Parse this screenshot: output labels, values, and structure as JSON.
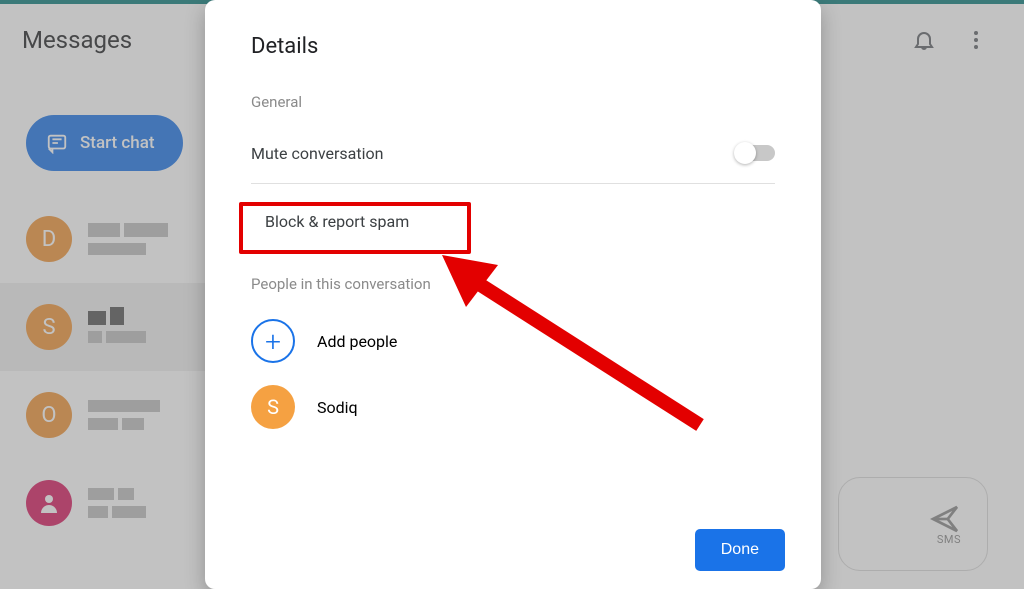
{
  "app": {
    "title": "Messages"
  },
  "header": {
    "bell_icon": "notifications",
    "more_icon": "more"
  },
  "start_chat": {
    "label": "Start chat"
  },
  "conversations": [
    {
      "initial": "D",
      "color": "#f09436"
    },
    {
      "initial": "S",
      "color": "#f09436"
    },
    {
      "initial": "O",
      "color": "#f09436"
    },
    {
      "initial": "",
      "color": "#d81b60",
      "person_icon": true
    }
  ],
  "sms_button": {
    "label": "SMS"
  },
  "dialog": {
    "title": "Details",
    "general_label": "General",
    "mute_label": "Mute conversation",
    "mute_on": false,
    "block_label": "Block & report spam",
    "people_label": "People in this conversation",
    "add_people_label": "Add people",
    "person_name": "Sodiq",
    "person_initial": "S",
    "person_color": "#f5a142",
    "done_label": "Done"
  }
}
